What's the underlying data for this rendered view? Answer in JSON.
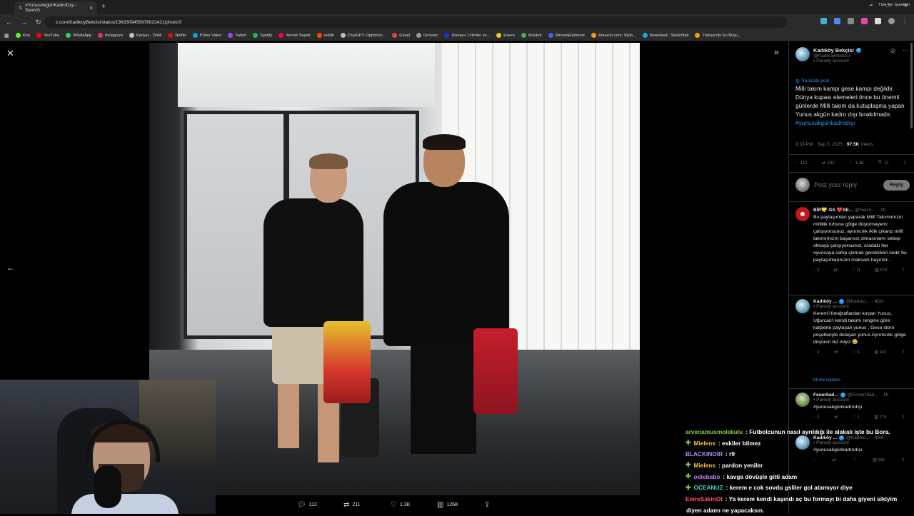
{
  "browser": {
    "tab_title": "#YunusAkgünKadroDışı - Search",
    "url": "x.com/KadikoyBekcisi/status/1963309456978022421/photo/3",
    "bookmarks": [
      {
        "label": "Kick",
        "color": "#53fc18"
      },
      {
        "label": "YouTube",
        "color": "#ff0000"
      },
      {
        "label": "WhatsApp",
        "color": "#25d366"
      },
      {
        "label": "Instagram",
        "color": "#e1306c"
      },
      {
        "label": "Kariyer - OSM",
        "color": "#c0c0c0"
      },
      {
        "label": "Netflix",
        "color": "#e50914"
      },
      {
        "label": "Prime Video",
        "color": "#00a8e1"
      },
      {
        "label": "Twitch",
        "color": "#9146ff"
      },
      {
        "label": "Spotify",
        "color": "#1db954"
      },
      {
        "label": "Yemek Sepeti",
        "color": "#fa0050"
      },
      {
        "label": "reddit",
        "color": "#ff4500"
      },
      {
        "label": "ChatGPT: Optimizin...",
        "color": "#bbbbbb"
      },
      {
        "label": "Gmail",
        "color": "#ea4335"
      },
      {
        "label": "Gnoosic",
        "color": "#999999"
      },
      {
        "label": "Disney+ | Filmler ve...",
        "color": "#113ccf"
      },
      {
        "label": "Exxen",
        "color": "#f5c518"
      },
      {
        "label": "Moobot",
        "color": "#4caf50"
      },
      {
        "label": "StreamElements",
        "color": "#4b5cff"
      },
      {
        "label": "Amazon.com: Stylo...",
        "color": "#ff9900"
      },
      {
        "label": "Newsfeed - Sketchfab",
        "color": "#1caad9"
      },
      {
        "label": "Türkiye'nin En Büyü...",
        "color": "#f3a000"
      }
    ],
    "all_bookmarks": "Tüm Yer İşaretleri"
  },
  "photo_actions": {
    "replies": "112",
    "reposts": "211",
    "likes": "1.3K",
    "views": "126K"
  },
  "tweet": {
    "author": "Kadıköy Bekçisi",
    "handle": "@KadikoyBekcisi",
    "parody": "Parody account",
    "translate": "Translate post",
    "text": "Milli takım kampı gese kampı değildir. Dünya kupası elemeleri önce bu önemli günlerde Milli takım da kutuplaşma yapan Yunus akgün kadro dışı bırakılmadır.",
    "hashtag": "#yunusakgünkadrodışı",
    "time": "9:33 PM · Sep 3, 2025 · ",
    "views_count": "97.5K",
    "views_label": " Views",
    "stats": {
      "replies": "112",
      "reposts": "211",
      "likes": "1.3K",
      "bookmarks": "11"
    },
    "reply_placeholder": "Post your reply",
    "reply_button": "Reply"
  },
  "replies": [
    {
      "name": "BİR💛 GS ❤️SE...",
      "handle": "@Selcu...",
      "time": "· 1h",
      "parody": "",
      "text": "Bu paylaşımları yaparak Millî Takımımızın milllilik ruhuna gölge düşürmeyemi çalışıyorsunuz, ayrımcılık iklik çıkarıp millî takımımızın başarısız olmasınamı sebep olmaya çalışıyorsunuz, oradaki her oyuncaya sahip çıkmak gerekirken nedir bu paylaşımlarınızın maksadı hayırdır...",
      "stats": {
        "replies": "2",
        "reposts": "",
        "likes": "11",
        "views": "573"
      }
    },
    {
      "name": "Kadıköy ...",
      "handle": "@Kadıko...",
      "time": "· 42m",
      "parody": "Parody account",
      "text": "Kerem'i fotoğraflardan kırpan Yunus, Uğurcan'ı kendi takımı rengine göre kalplerle paylaşan yunus , Gese store poşetleriyle dolaşan yunus Ayrımcılık gölge düşüren biz miyiz 😂",
      "stats": {
        "replies": "4",
        "reposts": "",
        "likes": "6",
        "views": "432"
      }
    },
    {
      "name": "Fenerliad...",
      "handle": "@FenerUlad...",
      "time": "· 1h",
      "parody": "Parody account",
      "text": "#yunusakgünkadrodışı",
      "stats": {
        "replies": "2",
        "reposts": "",
        "likes": "1",
        "views": "775"
      }
    },
    {
      "name": "Kadıköy ...",
      "handle": "@Kadıko...",
      "time": "· 40m",
      "parody": "Parody account",
      "text": "#yunusakgünkadrodışı",
      "stats": {
        "replies": "",
        "reposts": "",
        "likes": "",
        "views": "566"
      }
    }
  ],
  "show_replies": "Show replies",
  "chat": [
    {
      "user": "arvenamusmolekulu",
      "color": "#7fd13b",
      "gem": false,
      "msg": " : Futbolcunun nasıl ayrıldığı ile alakalı işte bu Bora."
    },
    {
      "user": "Mielens",
      "color": "#f5c542",
      "gem": true,
      "msg": " : eskiler bilmez"
    },
    {
      "user": "BLACKINOIR",
      "color": "#b38cff",
      "gem": false,
      "msg": " : r9"
    },
    {
      "user": "Mielens",
      "color": "#f5c542",
      "gem": true,
      "msg": " : pardon yeniler"
    },
    {
      "user": "odiebabo",
      "color": "#c77dff",
      "gem": true,
      "msg": " : kavga dövüşle gitti adam"
    },
    {
      "user": "OCEANUZ",
      "color": "#38d9c9",
      "gem": true,
      "msg": " : kerem e cok sovdu gsliler gol atamıyor diye"
    },
    {
      "user": "EmreSakinOl",
      "color": "#ff4d6d",
      "gem": false,
      "msg": " : Ya kerem kendi kaşındı aç bu formayı bi daha giyeni sikiyim"
    }
  ],
  "chat_continuation": "diyen adamı ne yapacaksın."
}
